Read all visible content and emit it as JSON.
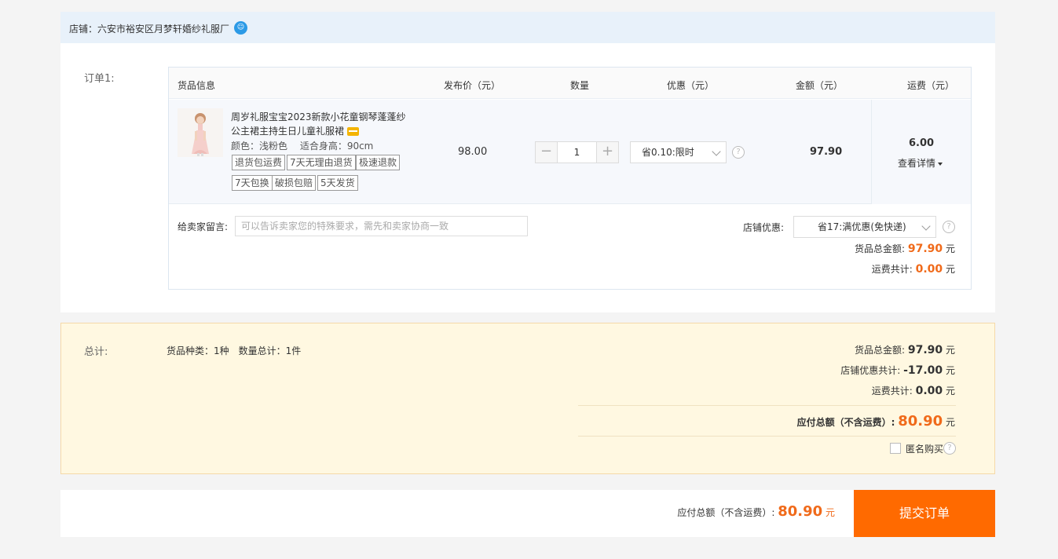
{
  "store": {
    "label": "店铺：六安市裕安区月梦轩婚纱礼服厂",
    "icon": "wangwang-chat-icon"
  },
  "order": {
    "label": "订单1:",
    "headers": {
      "goods": "货品信息",
      "price": "发布价（元）",
      "qty": "数量",
      "discount": "优惠（元）",
      "amount": "金额（元）",
      "shipping": "运费（元）"
    },
    "item": {
      "title_line1": "周岁礼服宝宝2023新款小花童钢琴蓬蓬纱",
      "title_line2": "公主裙主持生日儿童礼服裙",
      "spec": "颜色：浅粉色　 适合身高：90cm",
      "tags": [
        "退货包运费",
        "7天无理由退货",
        "极速退款",
        "7天包换",
        "破损包赔",
        "5天发货"
      ],
      "price": "98.00",
      "qty": "1",
      "discount_select": "省0.10:限时",
      "amount": "97.90",
      "shipping": "6.00",
      "shipping_detail": "查看详情"
    },
    "message_label": "给卖家留言:",
    "message_placeholder": "可以告诉卖家您的特殊要求，需先和卖家协商一致",
    "store_discount_label": "店铺优惠:",
    "store_discount_select": "省17:满优惠(免快递)",
    "goods_total_label": "货品总金额:",
    "goods_total": "97.90",
    "shipping_total_label": "运费共计:",
    "shipping_total": "0.00",
    "unit": "元"
  },
  "summary": {
    "label": "总计:",
    "kinds": "货品种类：1种　数量总计：1件",
    "goods_total_label": "货品总金额:",
    "goods_total": "97.90",
    "discount_label": "店铺优惠共计:",
    "discount_total": "-17.00",
    "shipping_label": "运费共计:",
    "shipping_total": "0.00",
    "payable_label": "应付总额（不含运费）:",
    "payable": "80.90",
    "anonymous_label": "匿名购买",
    "unit": "元"
  },
  "footer": {
    "payable_label": "应付总额（不含运费）:",
    "payable": "80.90",
    "unit": "元",
    "submit_label": "提交订单"
  },
  "colors": {
    "accent": "#ff6a00",
    "price_orange": "#f06a1a",
    "summary_bg": "#fff8e1",
    "store_bar_bg": "#e8f1fa"
  }
}
